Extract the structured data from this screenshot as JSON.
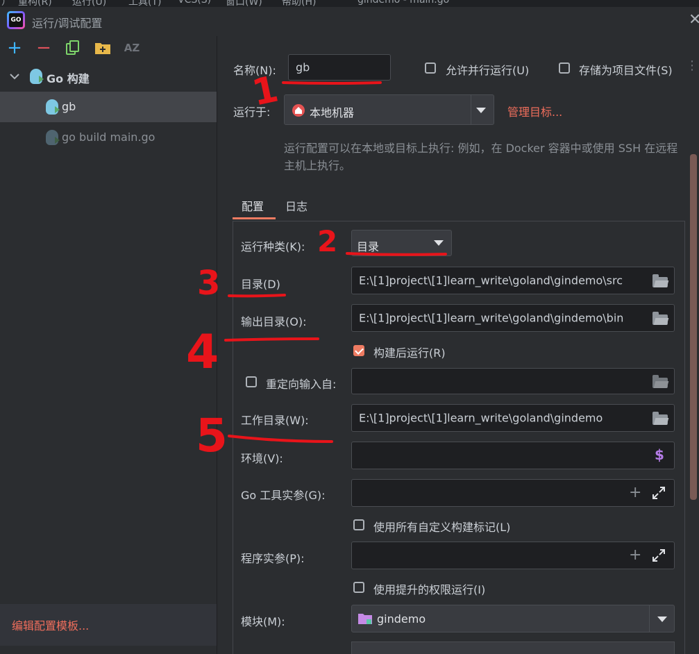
{
  "menu_strip": [
    "）",
    "重构(R)",
    "运行(U)",
    "工具(T)",
    "VCS(S)",
    "窗口(W)",
    "帮助(H)",
    "gindemo - main.go"
  ],
  "window": {
    "title": "运行/调试配置",
    "logo": "GO"
  },
  "toolbar": {
    "add": "+",
    "remove": "−",
    "copy_icon": "copy-icon",
    "folder_add_icon": "folder-add-icon",
    "sort": "AZ"
  },
  "tree": {
    "group_label": "Go 构建",
    "items": [
      {
        "label": "gb",
        "selected": true
      },
      {
        "label": "go build main.go",
        "selected": false
      }
    ]
  },
  "edit_templates": "编辑配置模板...",
  "form": {
    "name_label": "名称(N):",
    "name_value": "gb",
    "allow_parallel": "允许并行运行(U)",
    "store_as_project": "存储为项目文件(S)",
    "run_on_label": "运行于:",
    "run_on_value": "本地机器",
    "manage_targets": "管理目标...",
    "hint_line1": "运行配置可以在本地或目标上执行: 例如，在 Docker 容器中或使用 SSH 在远程",
    "hint_line2": "主机上执行。"
  },
  "tabs": [
    {
      "label": "配置",
      "active": true
    },
    {
      "label": "日志",
      "active": false
    }
  ],
  "config": {
    "run_kind_label": "运行种类(K):",
    "run_kind_value": "目录",
    "dir_label": "目录(D)",
    "dir_value": "E:\\[1]project\\[1]learn_write\\goland\\gindemo\\src",
    "out_label": "输出目录(O):",
    "out_value": "E:\\[1]project\\[1]learn_write\\goland\\gindemo\\bin",
    "run_after_build": "构建后运行(R)",
    "redirect_label": "重定向输入自:",
    "redirect_value": "",
    "workdir_label": "工作目录(W):",
    "workdir_value": "E:\\[1]project\\[1]learn_write\\goland\\gindemo",
    "env_label": "环境(V):",
    "env_value": "",
    "env_icon": "$",
    "go_tool_args_label": "Go 工具实参(G):",
    "use_custom_tags": "使用所有自定义构建标记(L)",
    "program_args_label": "程序实参(P):",
    "elevated": "使用提升的权限运行(I)",
    "module_label": "模块(M):",
    "module_value": "gindemo"
  },
  "checkbox_states": {
    "allow_parallel": false,
    "store_as_project": false,
    "run_after_build": true,
    "redirect": false,
    "use_custom_tags": false,
    "elevated": false
  },
  "annotations": [
    "1",
    "2",
    "3",
    "4",
    "5"
  ],
  "colors": {
    "accent": "#ee7b62",
    "link": "#f06e5c",
    "annotation": "#e8141a",
    "bg": "#2b2d30",
    "field_bg": "#1e1f22"
  }
}
